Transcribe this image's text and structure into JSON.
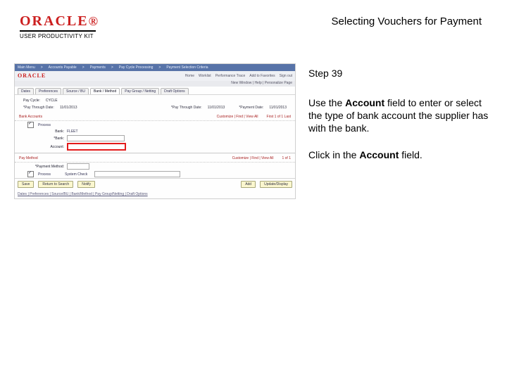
{
  "header": {
    "brand_wordmark": "ORACLE",
    "brand_subtitle": "USER PRODUCTIVITY KIT",
    "page_title": "Selecting Vouchers for Payment"
  },
  "instructions": {
    "step_label": "Step 39",
    "para1_pre": "Use the ",
    "para1_bold": "Account",
    "para1_post": " field to enter or select the type of bank account the supplier has with the bank.",
    "para2_pre": "Click in the ",
    "para2_bold": "Account",
    "para2_post": " field."
  },
  "app": {
    "menubar": [
      "Main Menu",
      "Accounts Payable",
      "Payments",
      "Pay Cycle Processing",
      "Payment Selection Criteria"
    ],
    "brand_mini": "ORACLE",
    "header_links": [
      "Home",
      "Worklist",
      "Performance Trace",
      "Add to Favorites",
      "Sign out"
    ],
    "search_label": "New Window | Help | Personalize Page",
    "tabs": [
      "Dates",
      "Preferences",
      "Source / BU",
      "Bank / Method",
      "Pay Group / Netting",
      "Draft Options"
    ],
    "active_tab_index": 3,
    "cycle_label": "Pay Cycle:",
    "cycle_value": "CYCLE",
    "paythru_label": "*Pay Through Date:",
    "paythru_value": "11/01/2013",
    "paydate_label": "*Pay Through Date:",
    "paydate_value": "11/01/2013",
    "paydate2_label": "*Payment Date:",
    "paydate2_value": "11/01/2013",
    "use_all_label": "Customize | Find | View All",
    "use_all_count": "First 1 of 1 Last",
    "bank_red": "Bank Accounts",
    "rows": {
      "r1_label": "Bank:",
      "r1_value": "FLEET",
      "r2_label": "*Bank:",
      "r2_value": "",
      "r3_label": "Account:",
      "r3_value": "",
      "process_label": "Process"
    },
    "pay_method_red": "Pay Method",
    "pm_row_label": "*Payment Method:",
    "pm_row_hint": "Customize | Find | View All",
    "pm_row_count": "1 of 1",
    "proc_label": "Process",
    "proc_option": "System Check",
    "bottom_buttons": [
      "Save",
      "Return to Search",
      "Notify"
    ],
    "bottom_buttons_right": [
      "Add",
      "Update/Display"
    ],
    "breadcrumb": "Dates | Preferences | Source/BU | Bank/Method | Pay Group/Netting | Draft Options"
  }
}
